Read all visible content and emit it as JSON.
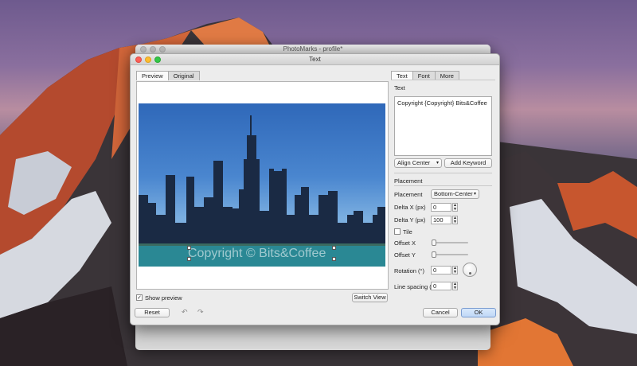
{
  "bg_window": {
    "title": "PhotoMarks - profile*"
  },
  "dialog": {
    "title": "Text",
    "left_tabs": [
      "Preview",
      "Original"
    ],
    "right_tabs": [
      "Text",
      "Font",
      "More"
    ],
    "watermark_text": "Copyright © Bits&Coffee",
    "show_preview_label": "Show preview",
    "show_preview_checked": "✓",
    "switch_view_label": "Switch View",
    "reset_label": "Reset",
    "undo_icon": "↶",
    "redo_icon": "↷",
    "text_section_label": "Text",
    "text_value": "Copyright {Copyright} Bits&Coffee",
    "align_select": "Align Center",
    "add_keyword_label": "Add Keyword",
    "placement_section_label": "Placement",
    "placement_label": "Placement",
    "placement_value": "Bottom-Center",
    "delta_x_label": "Delta X (px)",
    "delta_x_value": "0",
    "delta_y_label": "Delta Y (px)",
    "delta_y_value": "100",
    "tile_label": "Tile",
    "offset_x_label": "Offset X",
    "offset_y_label": "Offset Y",
    "rotation_label": "Rotation (°)",
    "rotation_value": "0",
    "line_spacing_label": "Line spacing (p",
    "line_spacing_value": "0",
    "cancel_label": "Cancel",
    "ok_label": "OK"
  }
}
